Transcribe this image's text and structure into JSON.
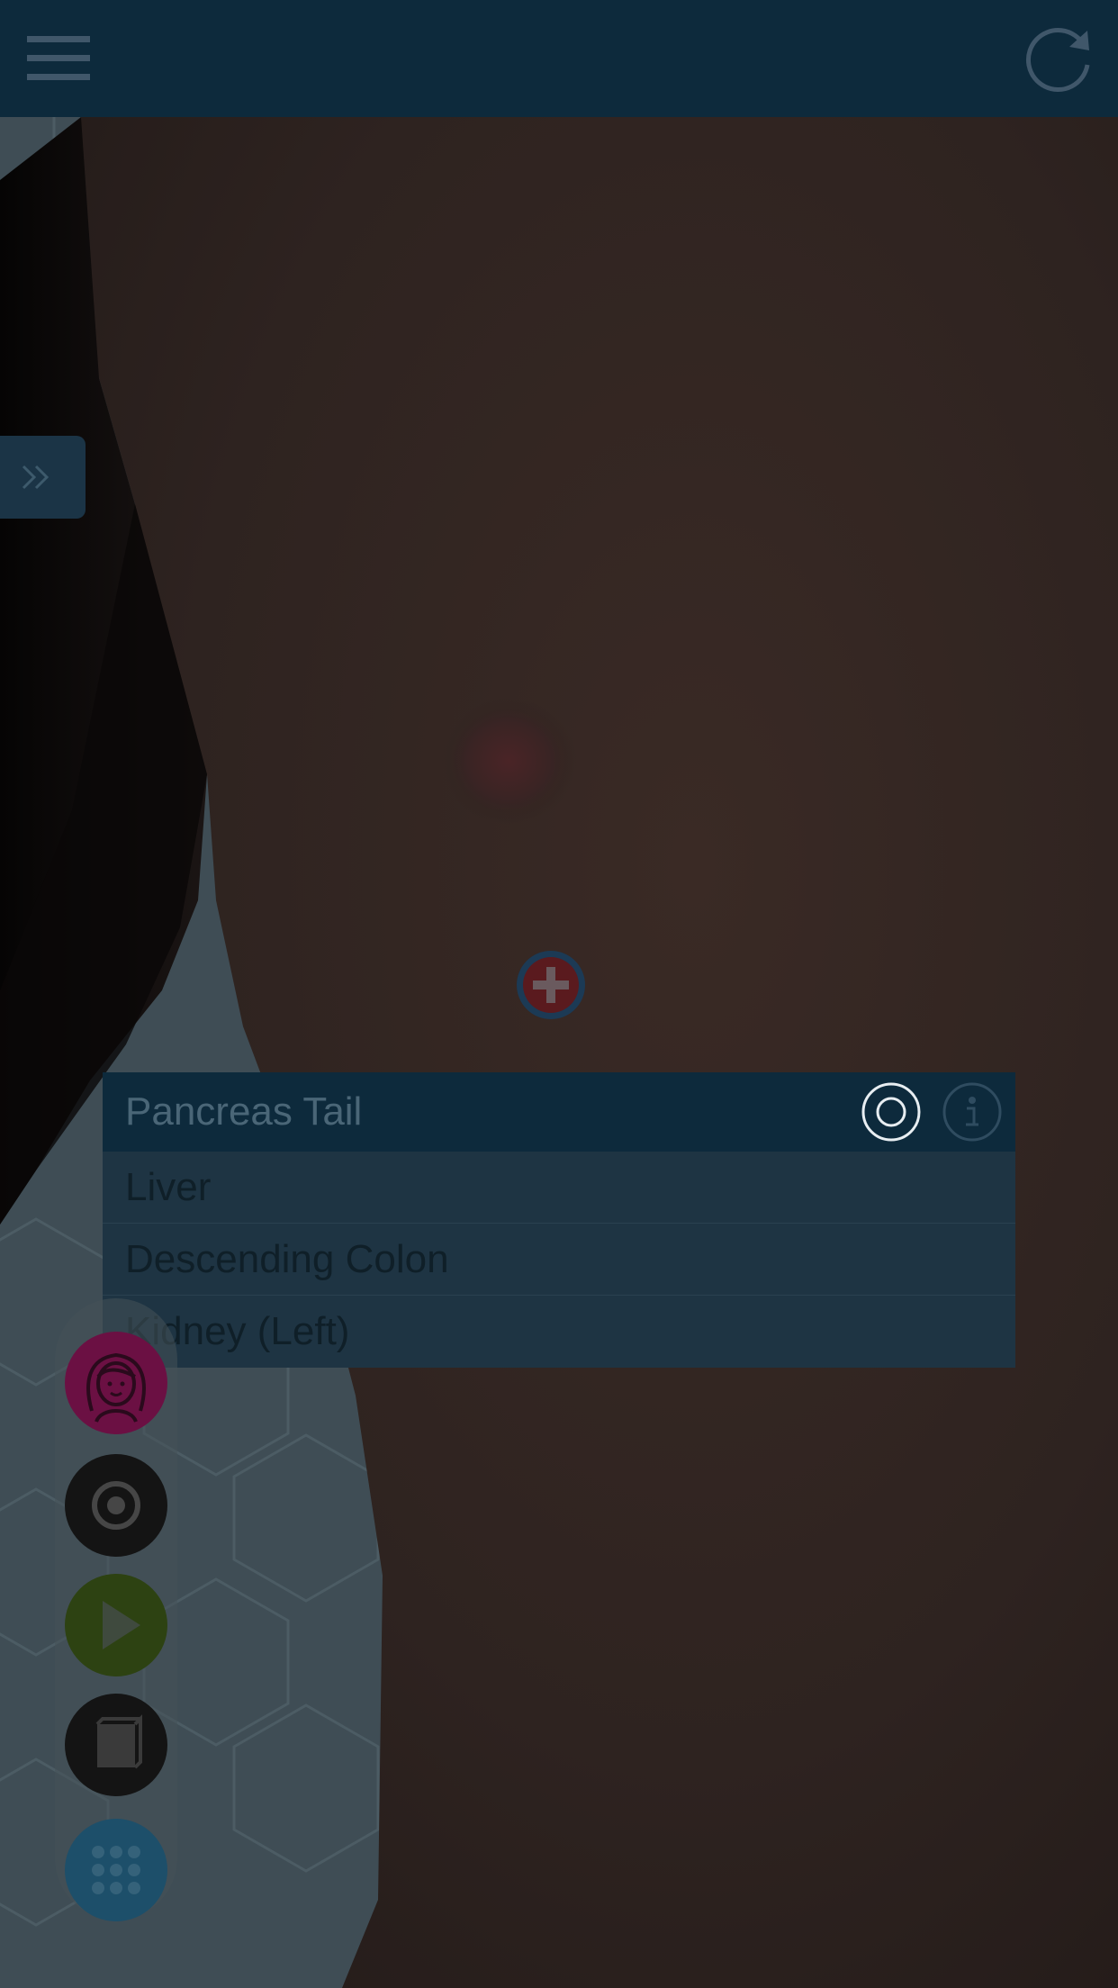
{
  "header": {
    "menu_icon": "hamburger-menu-icon",
    "refresh_icon": "refresh-icon"
  },
  "side_panel": {
    "expand_icon": "double-chevron-right-icon"
  },
  "marker": {
    "icon": "plus-circle-icon",
    "color": "#5a1a1e"
  },
  "organ_list": {
    "selected": "Pancreas Tail",
    "items": [
      {
        "label": "Pancreas Tail",
        "selected": true
      },
      {
        "label": "Liver",
        "selected": false
      },
      {
        "label": "Descending Colon",
        "selected": false
      },
      {
        "label": "Kidney (Left)",
        "selected": false
      }
    ],
    "actions": {
      "target_icon": "target-icon",
      "info_icon": "info-icon"
    }
  },
  "toolbar": {
    "items": [
      {
        "icon": "female-avatar-icon",
        "color": "#6b1043"
      },
      {
        "icon": "target-icon",
        "color": "#141414"
      },
      {
        "icon": "play-icon",
        "color": "#2d4212"
      },
      {
        "icon": "book-icon",
        "color": "#141414"
      },
      {
        "icon": "grid-dots-icon",
        "color": "#1d4f6a"
      }
    ]
  },
  "colors": {
    "header_bg": "#0d2a3c",
    "list_bg": "#1e3443",
    "list_selected_bg": "#0d2a3c",
    "accent": "#2c6a90"
  }
}
